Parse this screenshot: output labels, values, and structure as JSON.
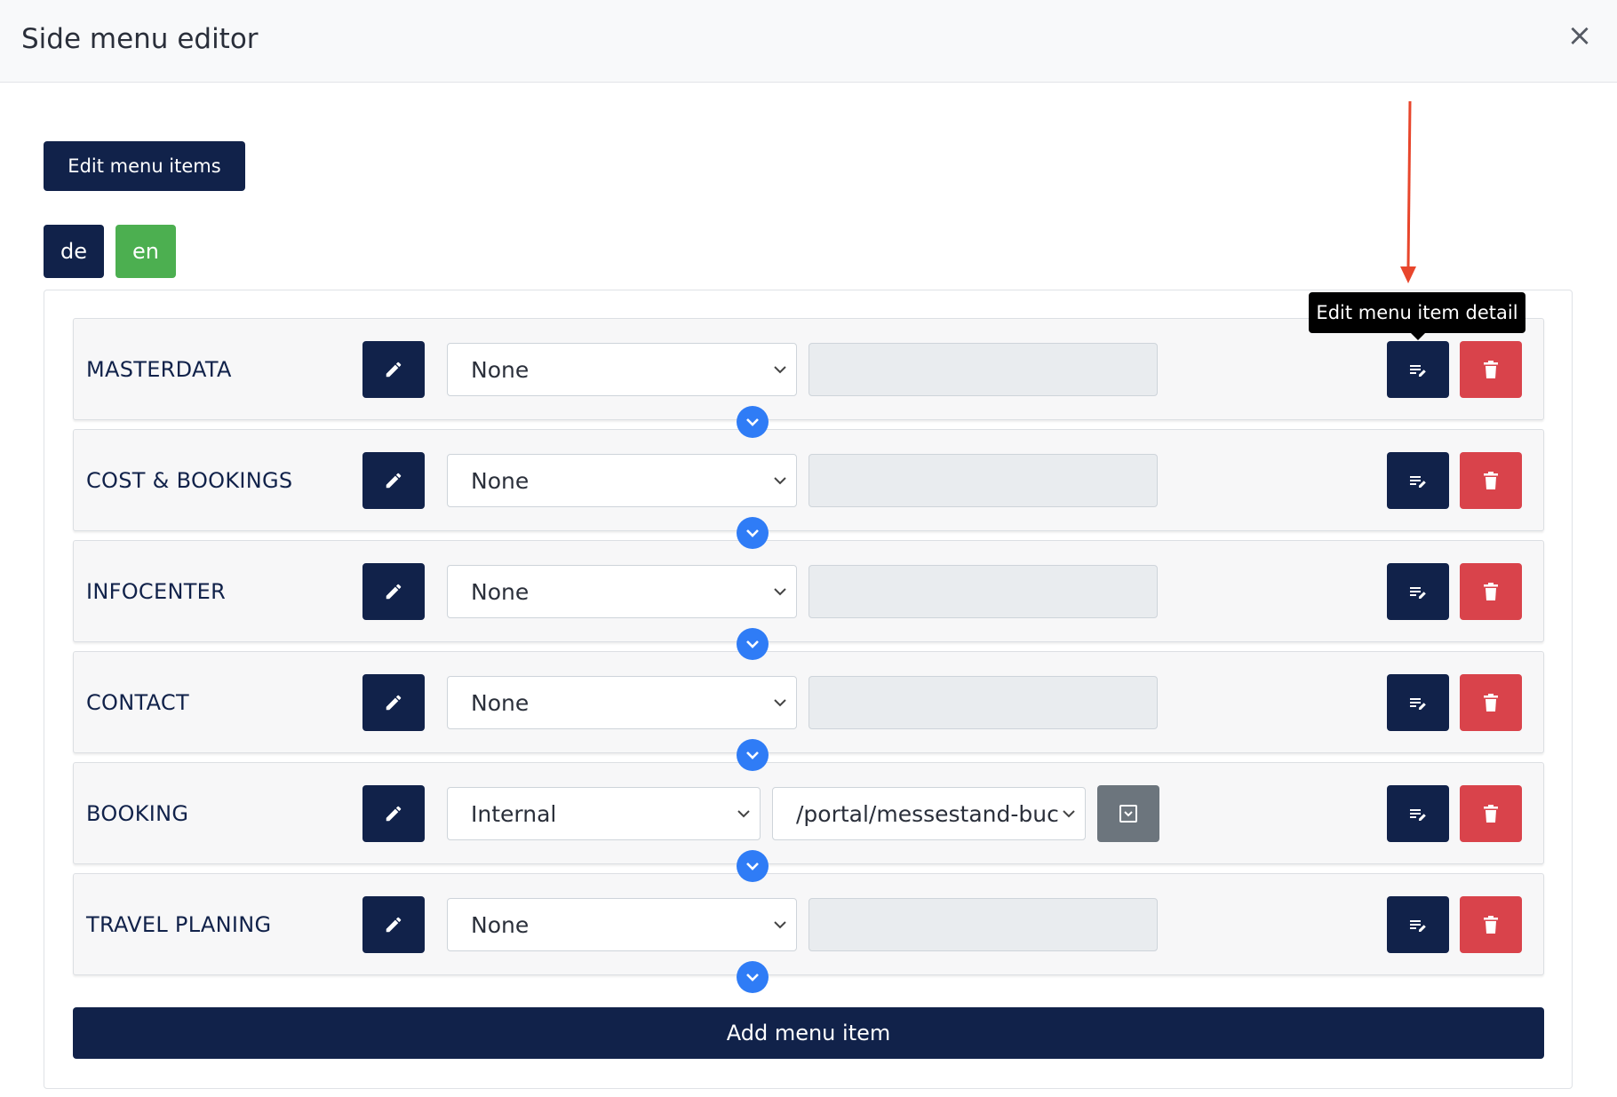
{
  "header": {
    "title": "Side menu editor",
    "close_label": "×"
  },
  "toolbar": {
    "edit_items_label": "Edit menu items"
  },
  "languages": [
    {
      "code": "de",
      "color": "#11224a"
    },
    {
      "code": "en",
      "color": "#4caf50"
    }
  ],
  "menu_items": [
    {
      "label": "MASTERDATA",
      "link_type": "None"
    },
    {
      "label": "COST & BOOKINGS",
      "link_type": "None"
    },
    {
      "label": "INFOCENTER",
      "link_type": "None"
    },
    {
      "label": "CONTACT",
      "link_type": "None"
    },
    {
      "label": "BOOKING",
      "link_type": "Internal",
      "link_target": "/portal/messestand-buc"
    },
    {
      "label": "TRAVEL PLANING",
      "link_type": "None"
    }
  ],
  "tooltip": {
    "text": "Edit menu item detail"
  },
  "footer": {
    "add_label": "Add menu item"
  },
  "colors": {
    "primary": "#11224a",
    "danger": "#d9434b",
    "success": "#4caf50",
    "accent": "#2f7cf6",
    "annotation": "#e8462c"
  }
}
